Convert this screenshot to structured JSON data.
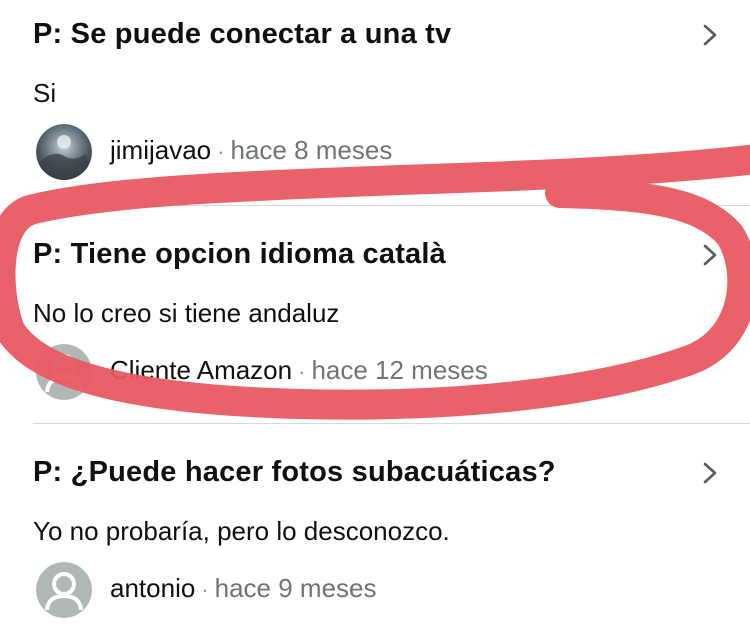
{
  "questions": [
    {
      "question": "P: Se puede conectar a una tv",
      "answer": "Si",
      "author": "jimijavao",
      "separator": "·",
      "date": "hace 8 meses"
    },
    {
      "question": "P: Tiene opcion idioma català",
      "answer": "No lo creo si tiene andaluz",
      "author": "Cliente Amazon",
      "separator": "·",
      "date": "hace 12 meses"
    },
    {
      "question": "P: ¿Puede hacer fotos subacuáticas?",
      "answer": "Yo no probaría, pero lo desconozco.",
      "author": "antonio",
      "separator": "·",
      "date": "hace 9 meses"
    }
  ],
  "icons": {
    "chevron": "chevron-right-icon",
    "avatar_photo": "user-photo-avatar",
    "avatar_default": "default-user-avatar"
  },
  "colors": {
    "highlight_stroke": "#e85a62",
    "text": "#0f1111",
    "muted": "#6f7478",
    "avatar_gray": "#b0b7b7"
  }
}
